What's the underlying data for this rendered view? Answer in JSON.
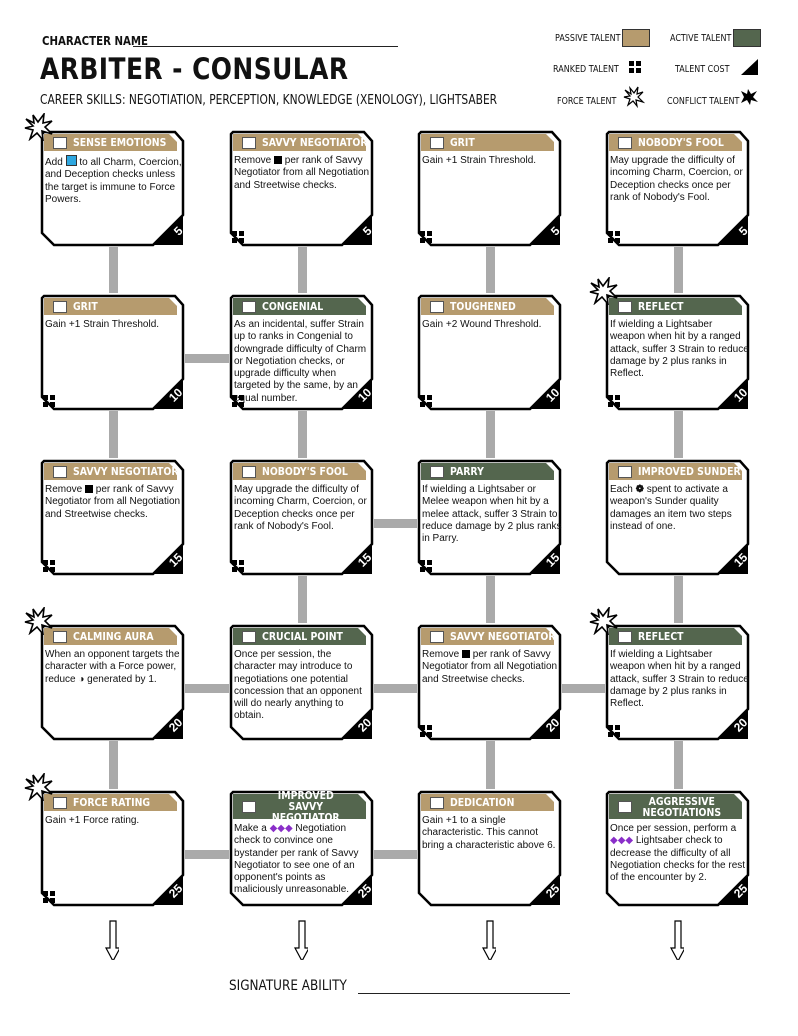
{
  "header": {
    "character_name_label": "CHARACTER NAME",
    "title": "ARBITER  -  CONSULAR",
    "career_skills": "CAREER SKILLS:  NEGOTIATION, PERCEPTION, KNOWLEDGE (XENOLOGY), LIGHTSABER"
  },
  "legend": {
    "passive": "PASSIVE TALENT",
    "active": "ACTIVE TALENT",
    "ranked": "RANKED TALENT",
    "cost": "TALENT COST",
    "force": "FORCE TALENT",
    "conflict": "CONFLICT TALENT",
    "passive_color": "#b69b6e",
    "active_color": "#54664e"
  },
  "rows": [
    [
      {
        "title": "SENSE EMOTIONS",
        "type": "passive",
        "cost": "5",
        "ranked": false,
        "force": true,
        "desc_pre": "Add ",
        "symbol": "boost",
        "desc": " to all Charm, Coercion, and Deception checks unless the target is immune to Force Powers."
      },
      {
        "title": "SAVVY NEGOTIATOR",
        "type": "passive",
        "cost": "5",
        "ranked": true,
        "force": false,
        "desc_pre": "Remove ",
        "symbol": "setback",
        "desc": " per rank of Savvy Negotiator from all Negotiation and Streetwise checks."
      },
      {
        "title": "GRIT",
        "type": "passive",
        "cost": "5",
        "ranked": true,
        "force": false,
        "desc_pre": "",
        "symbol": "",
        "desc": "Gain +1 Strain Threshold."
      },
      {
        "title": "NOBODY'S FOOL",
        "type": "passive",
        "cost": "5",
        "ranked": true,
        "force": false,
        "desc_pre": "",
        "symbol": "",
        "desc": "May upgrade the difficulty of incoming Charm, Coercion, or Deception checks once per rank of Nobody's Fool."
      }
    ],
    [
      {
        "title": "GRIT",
        "type": "passive",
        "cost": "10",
        "ranked": true,
        "force": false,
        "desc_pre": "",
        "symbol": "",
        "desc": "Gain +1 Strain Threshold."
      },
      {
        "title": "CONGENIAL",
        "type": "active",
        "cost": "10",
        "ranked": true,
        "force": false,
        "desc_pre": "",
        "symbol": "",
        "desc": "As an incidental, suffer Strain up to ranks in Congenial to downgrade difficulty of Charm or Negotiation checks, or upgrade difficulty when targeted by the same, by an equal number."
      },
      {
        "title": "TOUGHENED",
        "type": "passive",
        "cost": "10",
        "ranked": true,
        "force": false,
        "desc_pre": "",
        "symbol": "",
        "desc": "Gain +2 Wound Threshold."
      },
      {
        "title": "REFLECT",
        "type": "active",
        "cost": "10",
        "ranked": true,
        "force": true,
        "desc_pre": "",
        "symbol": "",
        "desc": "If wielding a Lightsaber weapon when hit by a ranged attack, suffer 3 Strain to reduce damage by 2 plus ranks in Reflect."
      }
    ],
    [
      {
        "title": "SAVVY NEGOTIATOR",
        "type": "passive",
        "cost": "15",
        "ranked": true,
        "force": false,
        "desc_pre": "Remove ",
        "symbol": "setback",
        "desc": " per rank of Savvy Negotiator from all Negotiation and Streetwise checks."
      },
      {
        "title": "NOBODY'S FOOL",
        "type": "passive",
        "cost": "15",
        "ranked": true,
        "force": false,
        "desc_pre": "",
        "symbol": "",
        "desc": "May upgrade the difficulty of incoming Charm, Coercion, or Deception checks once per rank of Nobody's Fool."
      },
      {
        "title": "PARRY",
        "type": "active",
        "cost": "15",
        "ranked": true,
        "force": false,
        "desc_pre": "",
        "symbol": "",
        "desc": "If wielding a Lightsaber or Melee weapon when hit by a melee attack, suffer 3 Strain to reduce damage by 2 plus ranks in Parry."
      },
      {
        "title": "IMPROVED SUNDER",
        "type": "passive",
        "cost": "15",
        "ranked": false,
        "force": false,
        "desc_pre": "Each ",
        "symbol": "triumph",
        "desc": " spent to activate a weapon's Sunder quality damages an item two steps instead of one."
      }
    ],
    [
      {
        "title": "CALMING AURA",
        "type": "passive",
        "cost": "20",
        "ranked": false,
        "force": true,
        "desc_pre": "",
        "symbol": "",
        "desc": "When an opponent targets the character with a Force power, reduce ◑ generated by 1."
      },
      {
        "title": "CRUCIAL POINT",
        "type": "active",
        "cost": "20",
        "ranked": false,
        "force": false,
        "desc_pre": "",
        "symbol": "",
        "desc": "Once per session, the character may introduce to negotiations one potential concession that an opponent will do nearly anything to obtain."
      },
      {
        "title": "SAVVY NEGOTIATOR",
        "type": "passive",
        "cost": "20",
        "ranked": true,
        "force": false,
        "desc_pre": "Remove ",
        "symbol": "setback",
        "desc": " per rank of Savvy Negotiator from all Negotiation and Streetwise checks."
      },
      {
        "title": "REFLECT",
        "type": "active",
        "cost": "20",
        "ranked": true,
        "force": true,
        "desc_pre": "",
        "symbol": "",
        "desc": "If wielding a Lightsaber weapon when hit by a ranged attack, suffer 3 Strain to reduce damage by 2 plus ranks in Reflect."
      }
    ],
    [
      {
        "title": "FORCE RATING",
        "type": "passive",
        "cost": "25",
        "ranked": true,
        "force": true,
        "desc_pre": "",
        "symbol": "",
        "desc": "Gain +1 Force rating."
      },
      {
        "title": "IMPROVED SAVVY NEGOTIATOR",
        "type": "active",
        "cost": "25",
        "ranked": false,
        "force": false,
        "desc_pre": "Make a ",
        "symbol": "difficulty3",
        "desc": " Negotiation check to convince one bystander per rank of Savvy Negotiator to see one of an opponent's points as maliciously unreasonable."
      },
      {
        "title": "DEDICATION",
        "type": "passive",
        "cost": "25",
        "ranked": false,
        "force": false,
        "desc_pre": "",
        "symbol": "",
        "desc": "Gain +1 to a single characteristic. This cannot bring a characteristic above 6."
      },
      {
        "title": "AGGRESSIVE NEGOTIATIONS",
        "type": "active",
        "cost": "25",
        "ranked": false,
        "force": false,
        "desc_pre": "Once per session, perform a ",
        "symbol": "difficulty3",
        "desc": " Lightsaber check to decrease the difficulty of all Negotiation checks for the rest of the encounter by 2."
      }
    ]
  ],
  "signature_label": "SIGNATURE ABILITY"
}
